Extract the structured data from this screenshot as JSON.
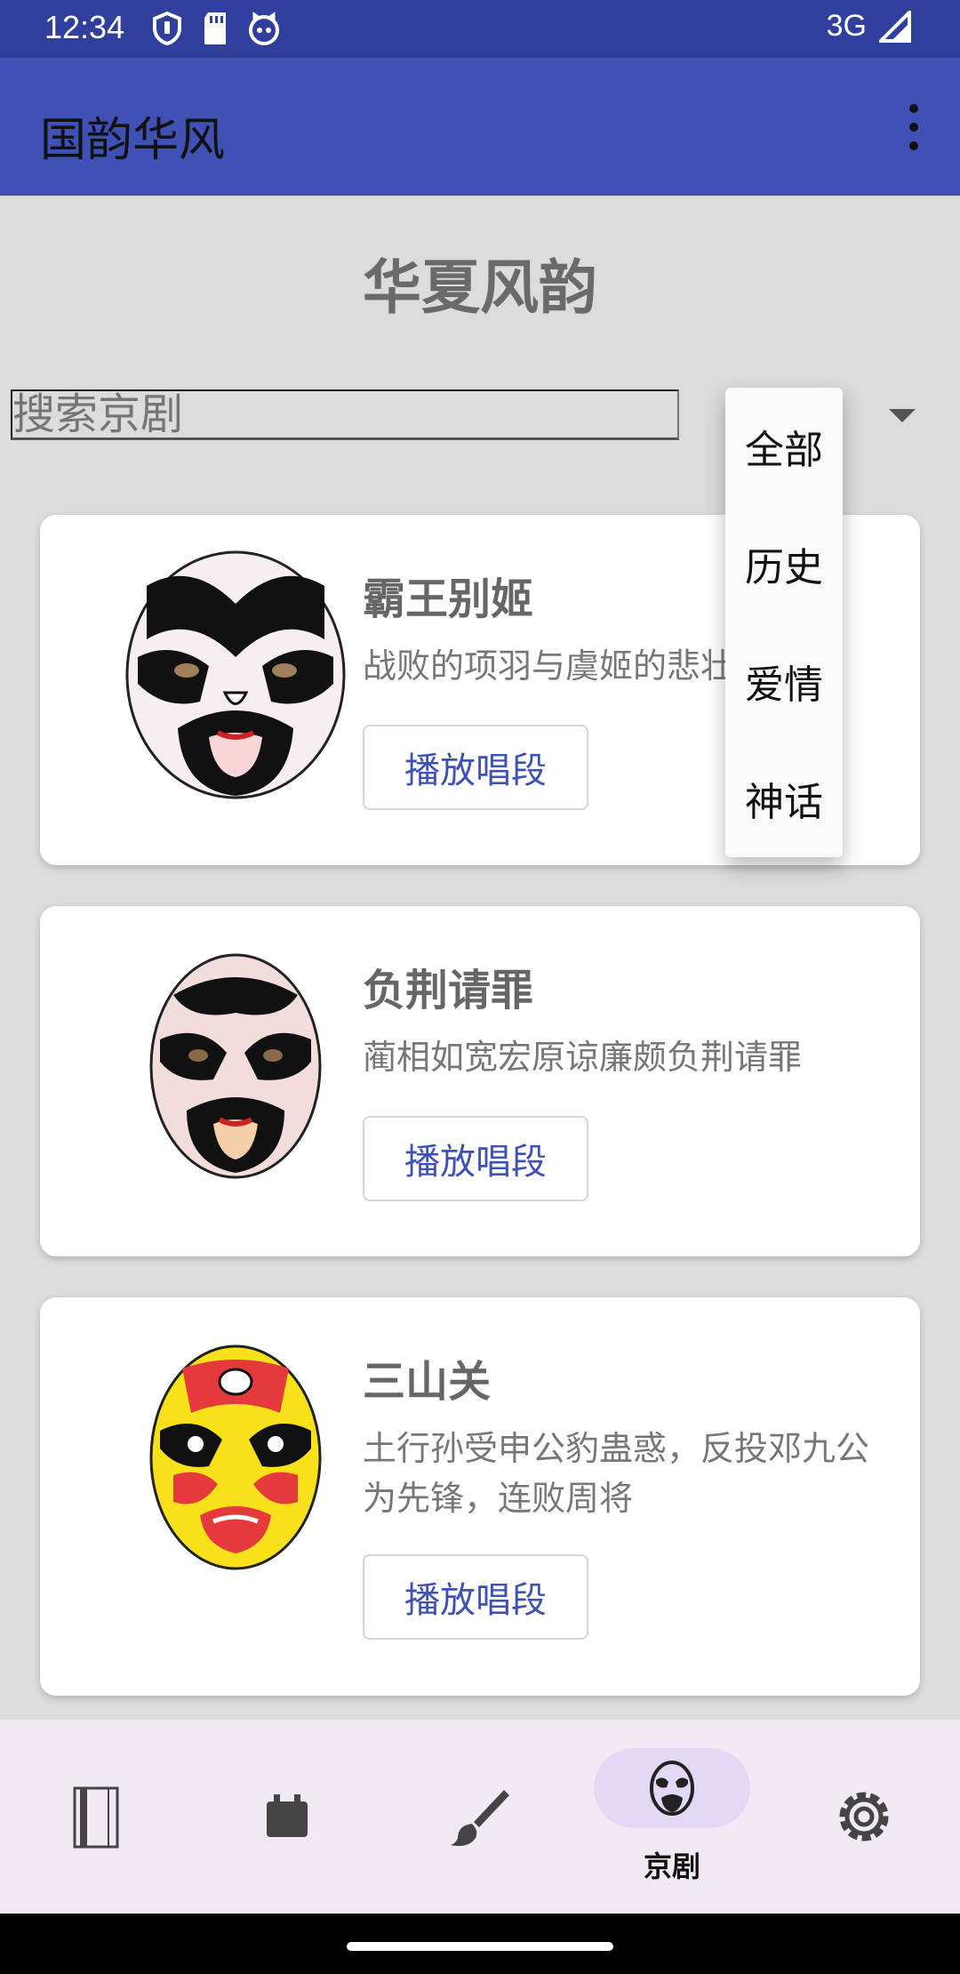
{
  "status_bar": {
    "time": "12:34",
    "network": "3G"
  },
  "app_bar": {
    "title": "国韵华风"
  },
  "page": {
    "heading": "华夏风韵"
  },
  "search": {
    "placeholder": "搜索京剧"
  },
  "category_menu": {
    "items": [
      "全部",
      "历史",
      "爱情",
      "神话"
    ]
  },
  "cards": [
    {
      "title": "霸王别姬",
      "description": "战败的项羽与虞姬的悲壮",
      "button": "播放唱段"
    },
    {
      "title": "负荆请罪",
      "description": "蔺相如宽宏原谅廉颇负荆请罪",
      "button": "播放唱段"
    },
    {
      "title": "三山关",
      "description": "土行孙受申公豹蛊惑，反投邓九公为先锋，连败周将",
      "button": "播放唱段"
    }
  ],
  "bottom_nav": {
    "active_label": "京剧"
  },
  "colors": {
    "primary": "#3f51b5",
    "status_bar": "#2f3f9b",
    "nav_active_pill": "#e3d9f7"
  }
}
